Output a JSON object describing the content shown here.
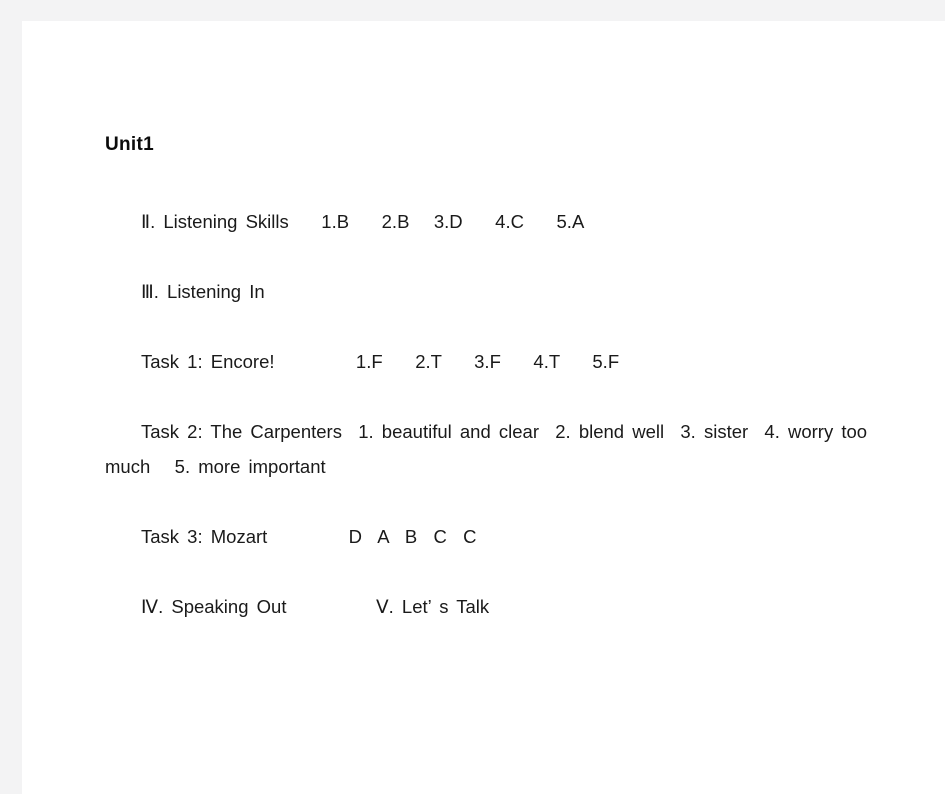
{
  "document": {
    "title": "Unit1",
    "paragraphs": [
      {
        "name": "listening-skills",
        "segments": [
          {
            "text": "Ⅱ. Listening Skills",
            "gap": "lg"
          },
          {
            "text": "1.B",
            "gap": "md"
          },
          {
            "text": "2.B",
            "gap": "sm"
          },
          {
            "text": "3.D",
            "gap": "md"
          },
          {
            "text": "4.C",
            "gap": "md"
          },
          {
            "text": "5.A",
            "gap": "none"
          }
        ],
        "plain": "Ⅱ. Listening Skills    1.B    2.B   3.D    4.C    5.A"
      },
      {
        "name": "listening-in",
        "segments": [
          {
            "text": "Ⅲ. Listening In",
            "gap": "none"
          }
        ],
        "plain": "Ⅲ. Listening In"
      },
      {
        "name": "task-1-encore",
        "segments": [
          {
            "text": "Task 1: Encore!",
            "gap": "xl"
          },
          {
            "text": "1.F",
            "gap": "md"
          },
          {
            "text": "2.T",
            "gap": "md"
          },
          {
            "text": "3.F",
            "gap": "md"
          },
          {
            "text": "4.T",
            "gap": "md"
          },
          {
            "text": "5.F",
            "gap": "none"
          }
        ],
        "plain": "Task 1: Encore!          1.F    2.T    3.F    4.T    5.F"
      },
      {
        "name": "task-2-the-carpenters",
        "segments": [
          {
            "text": "Task 2: The Carpenters",
            "gap": "sm"
          },
          {
            "text": "1. beautiful and clear",
            "gap": "sm"
          },
          {
            "text": "2. blend well",
            "gap": "sm"
          },
          {
            "text": "3. sister",
            "gap": "sm"
          },
          {
            "text": "4. worry too much",
            "gap": "sm"
          },
          {
            "text": "5. more important",
            "gap": "none"
          }
        ],
        "plain": "Task 2: The Carpenters  1. beautiful and clear  2. blend well  3. sister  4. worry too much   5. more important"
      },
      {
        "name": "task-3-mozart",
        "segments": [
          {
            "text": "Task 3: Mozart",
            "gap": "xl"
          },
          {
            "text": "D  A  B  C  C",
            "gap": "none"
          }
        ],
        "plain": "Task 3: Mozart          D  A  B  C  C"
      },
      {
        "name": "speaking-out-lets-talk",
        "segments": [
          {
            "text": "Ⅳ. Speaking Out",
            "gap": "xl"
          },
          {
            "text": "Ⅴ. Let’ s Talk",
            "gap": "none"
          }
        ],
        "plain": "Ⅳ. Speaking Out           Ⅴ. Let’ s Talk"
      }
    ]
  },
  "colors": {
    "page_background": "#ffffff",
    "canvas_background": "#f3f3f4",
    "text": "#1a1a1a",
    "title_text": "#0b0b0b"
  }
}
